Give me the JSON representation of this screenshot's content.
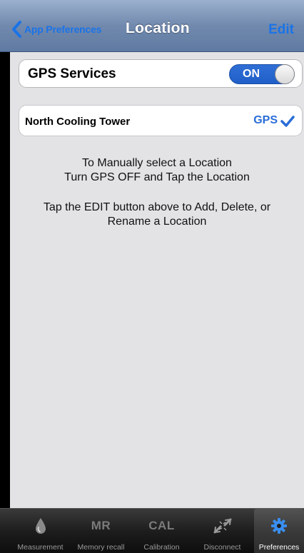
{
  "navbar": {
    "back_label": "App Preferences",
    "title": "Location",
    "edit_label": "Edit"
  },
  "gps": {
    "label": "GPS Services",
    "toggle_state": "ON"
  },
  "location": {
    "name": "North Cooling Tower",
    "source": "GPS"
  },
  "instructions": {
    "line1": "To Manually select a Location",
    "line2": "Turn GPS OFF and Tap the Location",
    "line3": "Tap the EDIT button above to Add, Delete, or",
    "line4": "Rename a Location"
  },
  "tabbar": {
    "tabs": [
      {
        "label": "Measurement",
        "icon": "drop-icon"
      },
      {
        "label": "Memory recall",
        "icon_text": "MR"
      },
      {
        "label": "Calibration",
        "icon_text": "CAL"
      },
      {
        "label": "Disconnect",
        "icon": "disconnect-arrows-icon"
      },
      {
        "label": "Preferences",
        "icon": "gear-icon"
      }
    ]
  },
  "colors": {
    "accent": "#1a73e8",
    "navbar": "#7189ad",
    "background": "#e3e3e6",
    "toggle_on": "#2f6fd6"
  }
}
